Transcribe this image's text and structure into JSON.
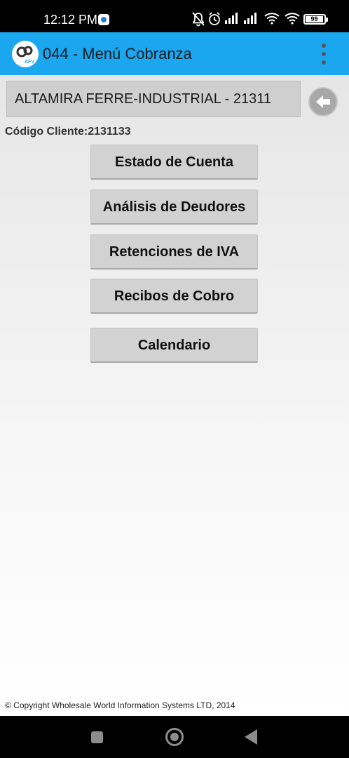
{
  "status_bar": {
    "time": "12:12 PM",
    "battery": "99",
    "icons": [
      "notification-app-icon",
      "mute-bell-icon",
      "alarm-icon",
      "signal-icon",
      "signal-icon",
      "wifi-icon",
      "wifi-icon",
      "battery-icon"
    ]
  },
  "app_bar": {
    "title": "044 - Menú Cobranza",
    "logo_text": "AFV",
    "overflow_icon": "more-vert-icon",
    "color": "#1aa7f0"
  },
  "client": {
    "name_field": "ALTAMIRA FERRE-INDUSTRIAL - 21311",
    "codigo": "Código Cliente:2131133",
    "back_icon": "arrow-left-icon"
  },
  "menu": {
    "items": [
      {
        "label": "Estado de Cuenta"
      },
      {
        "label": "Análisis de Deudores"
      },
      {
        "label": "Retenciones de IVA"
      },
      {
        "label": "Recibos de Cobro"
      },
      {
        "label": "Calendario"
      }
    ]
  },
  "footer": {
    "copyright": "© Copyright Wholesale World Information Systems LTD, 2014"
  },
  "nav_bar": {
    "icons": [
      "recents-square-icon",
      "home-circle-icon",
      "back-triangle-icon"
    ]
  }
}
